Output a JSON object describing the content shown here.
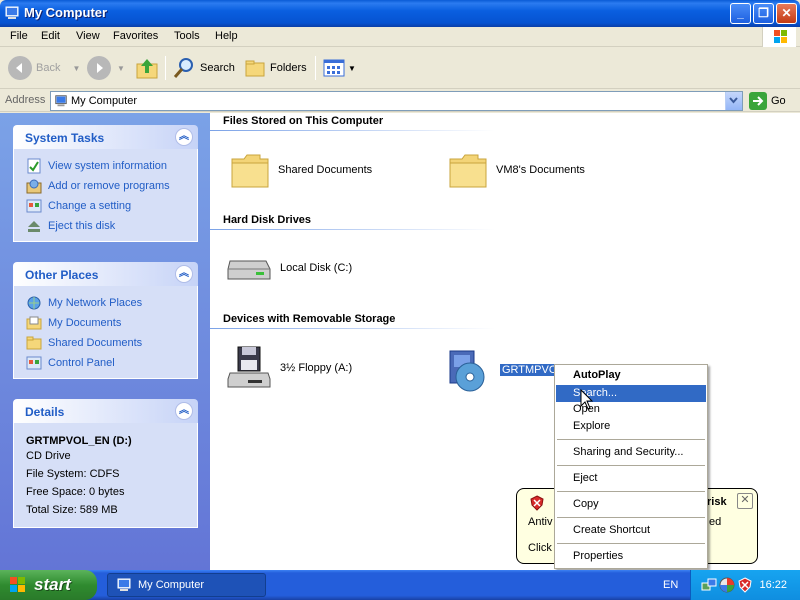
{
  "window": {
    "title": "My Computer",
    "min_glyph": "_",
    "max_glyph": "❐",
    "close_glyph": "✕"
  },
  "menubar": {
    "items": [
      "File",
      "Edit",
      "View",
      "Favorites",
      "Tools",
      "Help"
    ]
  },
  "toolbar": {
    "back_label": "Back",
    "search_label": "Search",
    "folders_label": "Folders"
  },
  "address": {
    "label": "Address",
    "value": "My Computer",
    "go_label": "Go"
  },
  "left_pane": {
    "system_tasks": {
      "title": "System Tasks",
      "items": [
        "View system information",
        "Add or remove programs",
        "Change a setting",
        "Eject this disk"
      ]
    },
    "other_places": {
      "title": "Other Places",
      "items": [
        "My Network Places",
        "My Documents",
        "Shared Documents",
        "Control Panel"
      ]
    },
    "details": {
      "title": "Details",
      "name": "GRTMPVOL_EN (D:)",
      "lines": [
        "CD Drive",
        "File System: CDFS",
        "Free Space: 0 bytes",
        "Total Size: 589 MB"
      ]
    }
  },
  "main": {
    "groups": [
      {
        "title": "Files Stored on This Computer",
        "items": [
          "Shared Documents",
          "VM8's Documents"
        ]
      },
      {
        "title": "Hard Disk Drives",
        "items": [
          "Local Disk (C:)"
        ]
      },
      {
        "title": "Devices with Removable Storage",
        "items": [
          "3½ Floppy (A:)",
          "GRTMPVOL_EN (D:)"
        ]
      }
    ]
  },
  "context_menu": {
    "items": [
      "AutoPlay",
      "Search...",
      "Open",
      "Explore",
      "Sharing and Security...",
      "Eject",
      "Copy",
      "Create Shortcut",
      "Properties"
    ],
    "highlighted": "Search..."
  },
  "balloon": {
    "title_fragment": "risk",
    "line1_left": "Antiv",
    "line1_right": "ed",
    "line2_left": "Click"
  },
  "taskbar": {
    "start_label": "start",
    "task_label": "My Computer",
    "language": "EN",
    "clock": "16:22"
  },
  "colors": {
    "titlebar_blue": "#0a5fe0",
    "link_blue": "#215dc6",
    "selection_blue": "#316ac5",
    "start_green": "#2f8b2f"
  }
}
